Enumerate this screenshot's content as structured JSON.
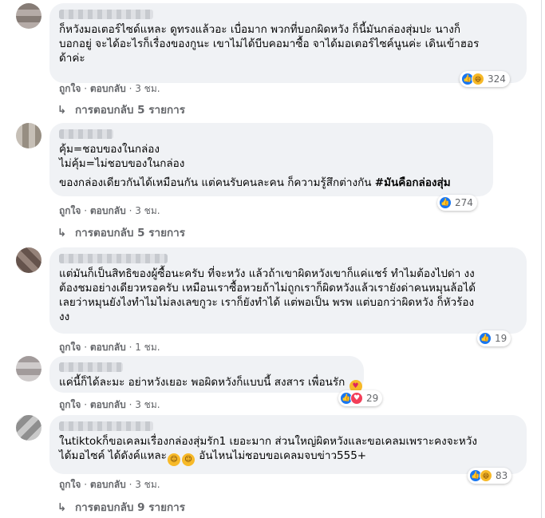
{
  "comments": [
    {
      "lines": [
        "ก็หวังมอเตอร์ไซด์แหละ ดูทรงแล้วอะ เบื่อมาก พวกที่บอกผิดหวัง ก็นี้มันกล่องสุ่มปะ นางก็",
        "บอกอยู่ จะได้อะไรก็เรื่องของกูนะ เขาไม่ได้บีบคอมาซื้อ จาได้มอเตอร์ไซค์นูนค่ะ เดินเข้าฮอร",
        "ด้าค่ะ"
      ],
      "reaction_count": "324",
      "meta": {
        "like": "ถูกใจ",
        "reply": "ตอบกลับ",
        "time": "3 ชม."
      },
      "replies_label": "การตอบกลับ 5 รายการ"
    },
    {
      "lines": [
        "คุ้ม=ชอบของในกล่อง",
        "ไม่คุ้ม=ไม่ชอบของในกล่อง",
        "",
        "ของกล่องเดียวกันได้เหมือนกัน แต่คนรับคนละคน ก็ความรู้สึกต่างกัน"
      ],
      "hashtag": "#มันคือกล่องสุ่ม",
      "reaction_count": "274",
      "meta": {
        "like": "ถูกใจ",
        "reply": "ตอบกลับ",
        "time": "3 ชม."
      },
      "replies_label": "การตอบกลับ 5 รายการ"
    },
    {
      "lines": [
        "แต่มันก็เป็นสิทธิของผู้ซื้อนะครับ ที่จะหวัง แล้วถ้าเขาผิดหวังเขาก็แค่แชร์ ทำไมต้องไปด่า งง",
        "ต้องชมอย่างเดียวหรอครับ เหมือนเราซื้อหวยถ้าไม่ถูกเราก็ผิดหวังแล้วเรายังด่าคนหมุนล้อได้",
        "เลยว่าหมุนยังไงทำไมไม่ลงเลขกูวะ เราก็ยังทำได้ แต่พอเป็น พรพ แต่บอกว่าผิดหวัง ก็หัวร้อง",
        "งง"
      ],
      "reaction_count": "19",
      "meta": {
        "like": "ถูกใจ",
        "reply": "ตอบกลับ",
        "time": "1 ชม."
      }
    },
    {
      "lines": [
        "แค่นี้ก็ได้ละมะ อย่าหวังเยอะ พอผิดหวังก็แบบนี้ สงสาร เพื่อนรัก"
      ],
      "reaction_count": "29",
      "meta": {
        "like": "ถูกใจ",
        "reply": "ตอบกลับ",
        "time": "3 ชม."
      }
    },
    {
      "lines": [
        "ในtiktokก็ขอเคลมเรื่องกล่องสุ่มรัก1 เยอะมาก ส่วนใหญ่ผิดหวังและขอเคลมเพราะคงจะหวัง",
        "ได้มอไซค์ ได้ดังค์แหละ",
        "อันไหนไม่ชอบขอเคลมจบข่าว555+"
      ],
      "reaction_count": "83",
      "meta": {
        "like": "ถูกใจ",
        "reply": "ตอบกลับ",
        "time": "3 ชม."
      },
      "replies_label": "การตอบกลับ 9 รายการ"
    }
  ],
  "icons": {
    "like": "like-icon",
    "haha": "haha-icon",
    "love": "love-icon",
    "reply_arrow": "reply-arrow-icon"
  },
  "colors": {
    "bubble": "#f0f2f5",
    "like_blue": "#1877f2",
    "meta_gray": "#65676b"
  }
}
